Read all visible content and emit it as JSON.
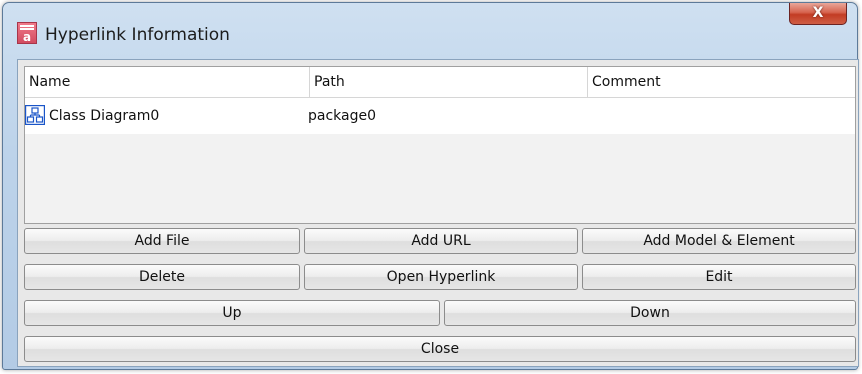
{
  "window": {
    "title": "Hyperlink Information",
    "app_icon_text": "a",
    "close_symbol": "X"
  },
  "table": {
    "columns": [
      "Name",
      "Path",
      "Comment"
    ],
    "rows": [
      {
        "name": "Class Diagram0",
        "path": "package0",
        "comment": "",
        "icon": "class-diagram-icon"
      }
    ]
  },
  "buttons": {
    "add_file": "Add File",
    "add_url": "Add URL",
    "add_model_element": "Add Model & Element",
    "delete": "Delete",
    "open_hyperlink": "Open Hyperlink",
    "edit": "Edit",
    "up": "Up",
    "down": "Down",
    "close": "Close"
  },
  "colors": {
    "titlebar": "#c4d8ee",
    "close_button": "#c94a33",
    "app_icon": "#d24b60",
    "diagram_icon": "#1a55c8"
  }
}
